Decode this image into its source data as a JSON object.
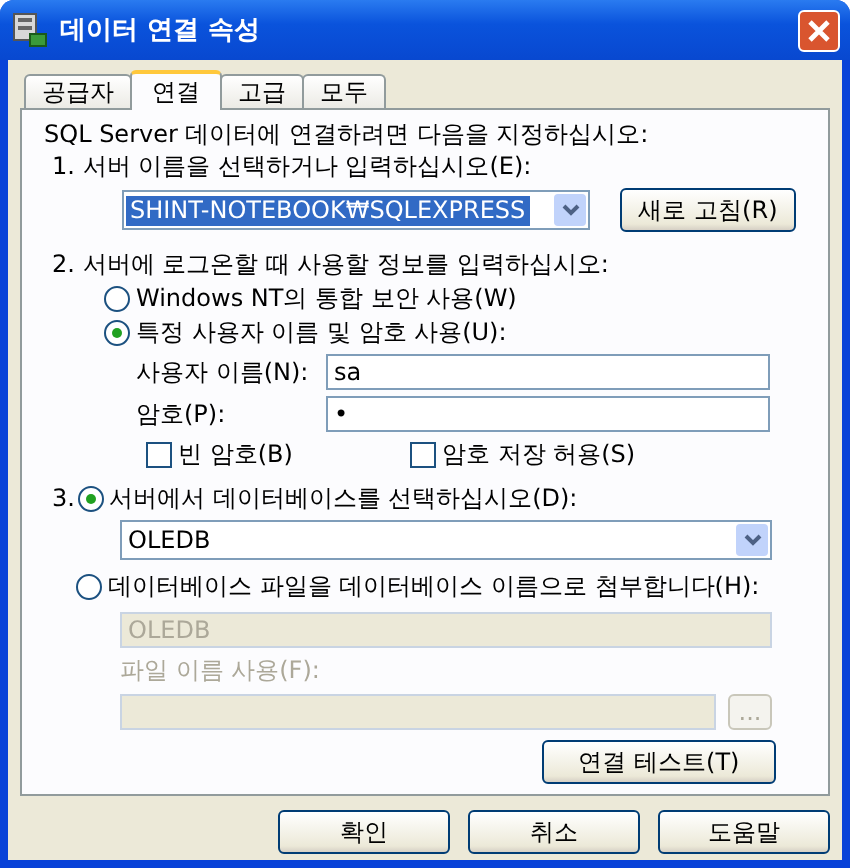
{
  "window": {
    "title": "데이터 연결 속성"
  },
  "tabs": [
    {
      "label": "공급자",
      "selected": false
    },
    {
      "label": "연결",
      "selected": true
    },
    {
      "label": "고급",
      "selected": false
    },
    {
      "label": "모두",
      "selected": false
    }
  ],
  "intro": "SQL Server 데이터에 연결하려면 다음을 지정하십시오:",
  "step1": {
    "label": "1. 서버 이름을 선택하거나 입력하십시오(E):",
    "server": {
      "value": "SHINT-NOTEBOOK₩SQLEXPRESS",
      "selected": true
    },
    "refresh_button": "새로 고침(R)"
  },
  "step2": {
    "label": "2. 서버에 로그온할 때 사용할 정보를 입력하십시오:",
    "options": [
      {
        "label": "Windows NT의 통합 보안 사용(W)",
        "selected": false
      },
      {
        "label": "특정 사용자 이름 및 암호 사용(U):",
        "selected": true
      }
    ],
    "username": {
      "label": "사용자 이름(N):",
      "value": "sa"
    },
    "password": {
      "label": "암호(P):",
      "value": "•"
    },
    "checkboxes": [
      {
        "label": "빈 암호(B)",
        "checked": false
      },
      {
        "label": "암호 저장 허용(S)",
        "checked": false
      }
    ]
  },
  "step3": {
    "number": "3.",
    "database_option": {
      "label": "서버에서 데이터베이스를 선택하십시오(D):",
      "selected": true
    },
    "database": "OLEDB",
    "attach_option": {
      "label": "데이터베이스 파일을 데이터베이스 이름으로 첨부합니다(H):",
      "selected": false
    },
    "attach_name": {
      "value": "OLEDB",
      "disabled": true
    },
    "file_label": {
      "label": "파일 이름 사용(F):",
      "disabled": true
    },
    "browse_button": {
      "label": "...",
      "disabled": true
    }
  },
  "test_button": "연결 테스트(T)",
  "buttons": [
    "확인",
    "취소",
    "도움말"
  ]
}
